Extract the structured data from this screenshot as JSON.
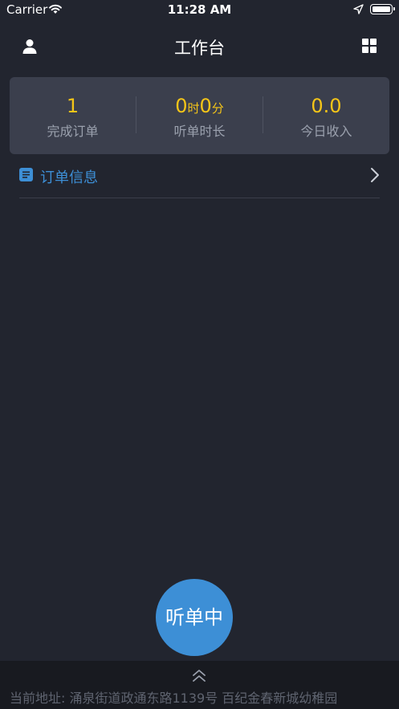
{
  "status_bar": {
    "carrier": "Carrier",
    "time": "11:28 AM"
  },
  "header": {
    "title": "工作台"
  },
  "stats": [
    {
      "value": "1",
      "label": "完成订单"
    },
    {
      "hours": "0",
      "hours_unit": "时",
      "minutes": "0",
      "minutes_unit": "分",
      "label": "听单时长"
    },
    {
      "value": "0.0",
      "label": "今日收入"
    }
  ],
  "order_section": {
    "label": "订单信息"
  },
  "listen_button": {
    "label": "听单中"
  },
  "footer": {
    "address": "当前地址:  涌泉街道政通东路1139号 百纪金春新城幼稚园"
  },
  "colors": {
    "background": "#22252f",
    "accent_blue": "#3d8fd6",
    "accent_yellow": "#f5c518",
    "card": "#3b3f4d"
  },
  "icons": [
    "wifi-icon",
    "location-arrow-icon",
    "battery-icon",
    "user-icon",
    "grid-icon",
    "document-icon",
    "chevron-right-icon",
    "chevron-double-up-icon"
  ]
}
